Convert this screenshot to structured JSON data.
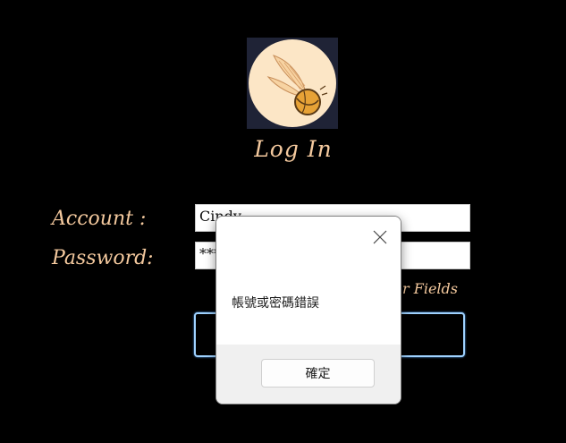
{
  "login": {
    "title": "Log In",
    "account_label": "Account :",
    "password_label": "Password:",
    "account_value": "Cindy",
    "password_value": "***",
    "clear_link_partial": "r Fields",
    "logo_icon": "golden-snitch-icon"
  },
  "dialog": {
    "message": "帳號或密碼錯誤",
    "ok_label": "確定",
    "close_icon": "close-icon"
  },
  "colors": {
    "background": "#000000",
    "accent_text": "#f4c99e",
    "button_focus_border": "#9fd2ff",
    "logo_bg": "#1f2336"
  }
}
